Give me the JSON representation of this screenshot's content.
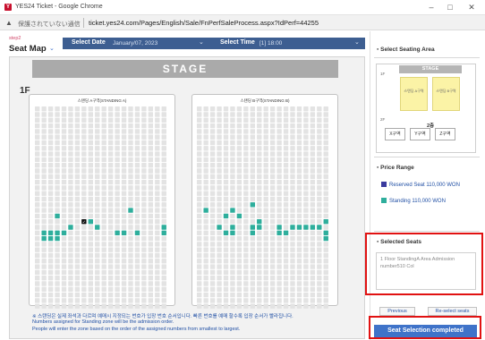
{
  "window": {
    "logo": "Y",
    "title": "YES24 Ticket - Google Chrome",
    "minimize": "–",
    "maximize": "□",
    "close": "✕"
  },
  "address_bar": {
    "warning_icon": "▲",
    "insecure_text": "保護されていない通信",
    "url": "ticket.yes24.com/Pages/English/Sale/FnPerfSaleProcess.aspx?IdPerf=44255"
  },
  "header": {
    "step": "step2",
    "title": "Seat Map",
    "title_caret": "⌄",
    "select_date_label": "Select Date",
    "select_date_value": "January/07, 2023",
    "select_time_label": "Select Time",
    "select_time_value": "[1] 18:00",
    "caret": "⌄"
  },
  "map": {
    "stage": "STAGE",
    "floor": "1F",
    "block_a_label": "스탠딩 A구역(STANDING A)",
    "block_b_label": "스탠딩 B구역(STANDING B)",
    "notes": [
      "※ 스탠딩은 실제 좌석과 다르며 예매시 지정되는 번호가 입장 번호 순서입니다. 빠른 번호를 예매 할수록 입장 순서가 빨라집니다.",
      "Numbers assigned for Standing zone will be the admission order.",
      "People will enter the zone based on the order of the assigned numbers from smallest to largest."
    ],
    "available_color": "#2eae9c",
    "selected_color": "#111111"
  },
  "side": {
    "seating_area_title": "Select Seating Area",
    "mini_map": {
      "stage": "STAGE",
      "floor1": "1F",
      "floor2": "2F",
      "zone_a": "스탠딩 A구역",
      "zone_b": "스탠딩 B구역",
      "balcony": "2층",
      "tiers": [
        "X구역",
        "Y구역",
        "Z구역"
      ]
    },
    "price_range_title": "Price Range",
    "prices": [
      {
        "label": "Reserved Seat 110,000 WON",
        "color": "#3a3a9e"
      },
      {
        "label": "Standing 110,000 WON",
        "color": "#2eae9c"
      }
    ],
    "selected_seats_title": "Selected Seats",
    "selected_seats_text": "1 Floor StandingA Area Admission number510 Col",
    "previous_button": "Previous",
    "reselect_button": "Re-select seats",
    "complete_button": "Seat Selection completed"
  }
}
